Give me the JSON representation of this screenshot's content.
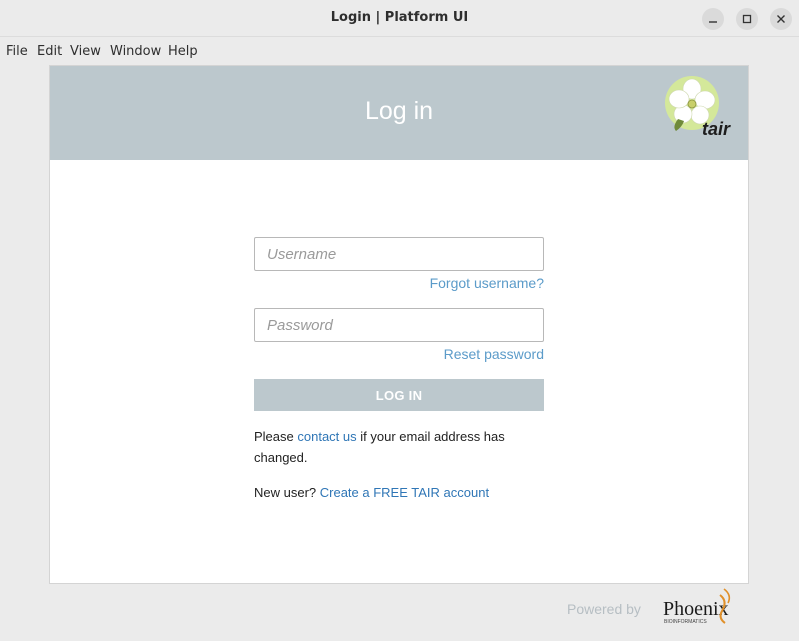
{
  "window": {
    "title": "Login | Platform UI",
    "controls": [
      "minimize",
      "maximize",
      "close"
    ]
  },
  "menubar": {
    "items": [
      "File",
      "Edit",
      "View",
      "Window",
      "Help"
    ]
  },
  "login": {
    "heading": "Log in",
    "logo_text": "tair",
    "username_placeholder": "Username",
    "username_value": "",
    "forgot_username": "Forgot username?",
    "password_placeholder": "Password",
    "password_value": "",
    "reset_password": "Reset password",
    "login_button": "LOG IN",
    "email_pre": "Please ",
    "email_link": "contact us",
    "email_post": " if your email address has changed.",
    "new_user_pre": "New user? ",
    "new_user_link": "Create a FREE TAIR account"
  },
  "footer": {
    "powered_by": "Powered by",
    "brand": "Phoenix",
    "brand_sub": "BIOINFORMATICS"
  },
  "colors": {
    "header_bg": "#bcc8cd",
    "link": "#5b9bc9",
    "link_dark": "#2f76b6"
  }
}
